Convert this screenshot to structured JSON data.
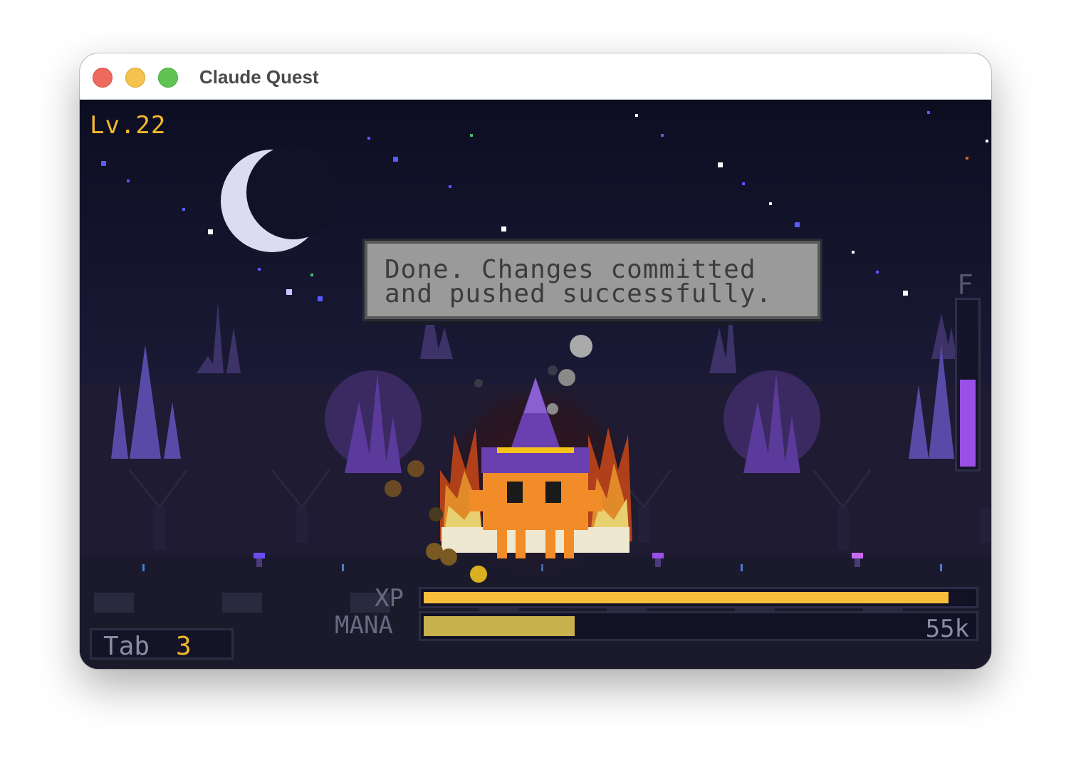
{
  "window": {
    "title": "Claude Quest"
  },
  "hud": {
    "level": "Lv.22",
    "tab_label": "Tab",
    "tab_number": "3",
    "xp_label": "XP",
    "mana_label": "MANA",
    "xp_fraction": 0.955,
    "mana_fraction": 0.275,
    "tokens": "55k",
    "energy_letter": "F",
    "energy_fraction": 0.53
  },
  "dialog": {
    "text": "Done. Changes committed and pushed successfully."
  },
  "colors": {
    "accent": "#f5b92e",
    "xp": "#f7be3c",
    "mana": "#c8b04c",
    "energy": "#9a4fe6",
    "sky": "#0f0f24",
    "character": "#f28c28",
    "hat": "#6a3fb0"
  },
  "icons": {
    "moon": "crescent-moon-icon",
    "character": "wizard-mascot-icon"
  }
}
